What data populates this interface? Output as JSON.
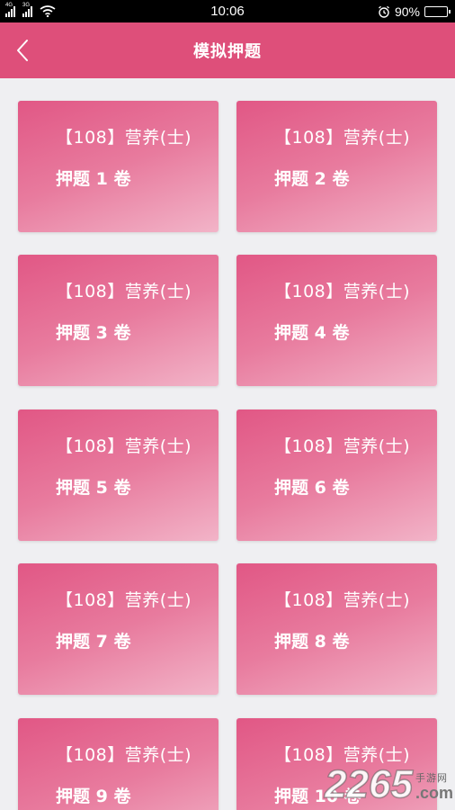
{
  "status_bar": {
    "network_1": "4G",
    "network_2": "3G",
    "time": "10:06",
    "battery_level": "90%"
  },
  "header": {
    "title": "模拟押题",
    "back_icon": "chevron-left-icon"
  },
  "cards": [
    {
      "subject": "【108】营养(士)",
      "paper": "押题 1 卷"
    },
    {
      "subject": "【108】营养(士)",
      "paper": "押题 2 卷"
    },
    {
      "subject": "【108】营养(士)",
      "paper": "押题 3 卷"
    },
    {
      "subject": "【108】营养(士)",
      "paper": "押题 4 卷"
    },
    {
      "subject": "【108】营养(士)",
      "paper": "押题 5 卷"
    },
    {
      "subject": "【108】营养(士)",
      "paper": "押题 6 卷"
    },
    {
      "subject": "【108】营养(士)",
      "paper": "押题 7 卷"
    },
    {
      "subject": "【108】营养(士)",
      "paper": "押题 8 卷"
    },
    {
      "subject": "【108】营养(士)",
      "paper": "押题 9 卷"
    },
    {
      "subject": "【108】营养(士)",
      "paper": "押题 10 卷"
    }
  ],
  "watermark": {
    "number": "2265",
    "site_cn": "手游网",
    "domain": ".com"
  },
  "colors": {
    "header": "#de4f7a",
    "card_start": "#e15785",
    "card_end": "#f2b4c8",
    "background": "#efeff2"
  }
}
